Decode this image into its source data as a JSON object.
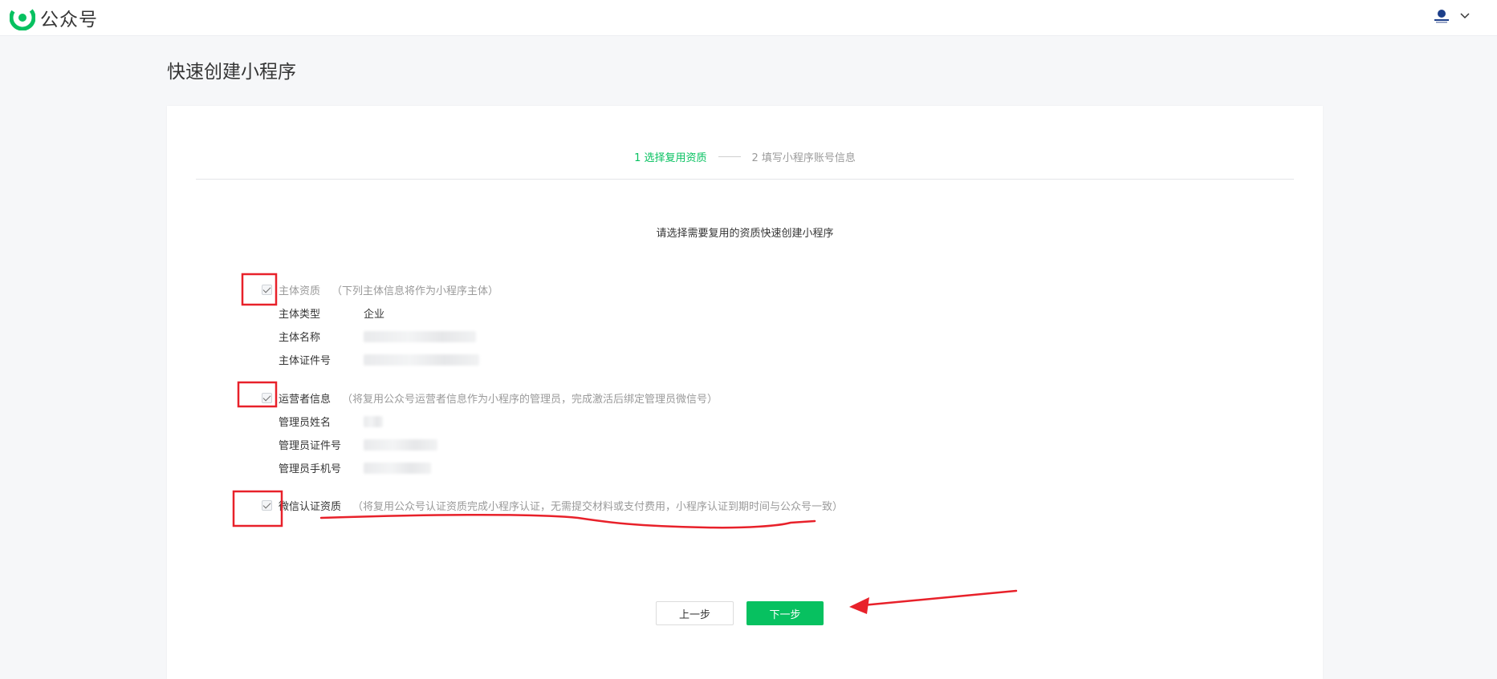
{
  "header": {
    "app_title": "公众号",
    "brand_color": "#07c160",
    "logo_icon": "wechat-official-account-logo",
    "avatar_icon": "account-avatar",
    "menu_icon": "chevron-down-icon"
  },
  "page": {
    "title": "快速创建小程序",
    "steps": [
      {
        "label": "1 选择复用资质",
        "active": true
      },
      {
        "label": "2 填写小程序账号信息",
        "active": false
      }
    ],
    "instruction": "请选择需要复用的资质快速创建小程序"
  },
  "sections": {
    "subject": {
      "title": "主体资质",
      "desc": "（下列主体信息将作为小程序主体）",
      "checked": true,
      "rows": [
        {
          "label": "主体类型",
          "value": "企业"
        },
        {
          "label": "主体名称",
          "value": ""
        },
        {
          "label": "主体证件号",
          "value": ""
        }
      ]
    },
    "operator": {
      "title": "运营者信息",
      "desc": "（将复用公众号运营者信息作为小程序的管理员，完成激活后绑定管理员微信号）",
      "checked": true,
      "rows": [
        {
          "label": "管理员姓名",
          "value": ""
        },
        {
          "label": "管理员证件号",
          "value": ""
        },
        {
          "label": "管理员手机号",
          "value": ""
        }
      ]
    },
    "certification": {
      "title": "微信认证资质",
      "desc": "（将复用公众号认证资质完成小程序认证，无需提交材料或支付费用，小程序认证到期时间与公众号一致）",
      "checked": true
    }
  },
  "buttons": {
    "prev_label": "上一步",
    "next_label": "下一步"
  },
  "colors": {
    "annotation": "#e8212a",
    "primary_button": "#07c160"
  }
}
